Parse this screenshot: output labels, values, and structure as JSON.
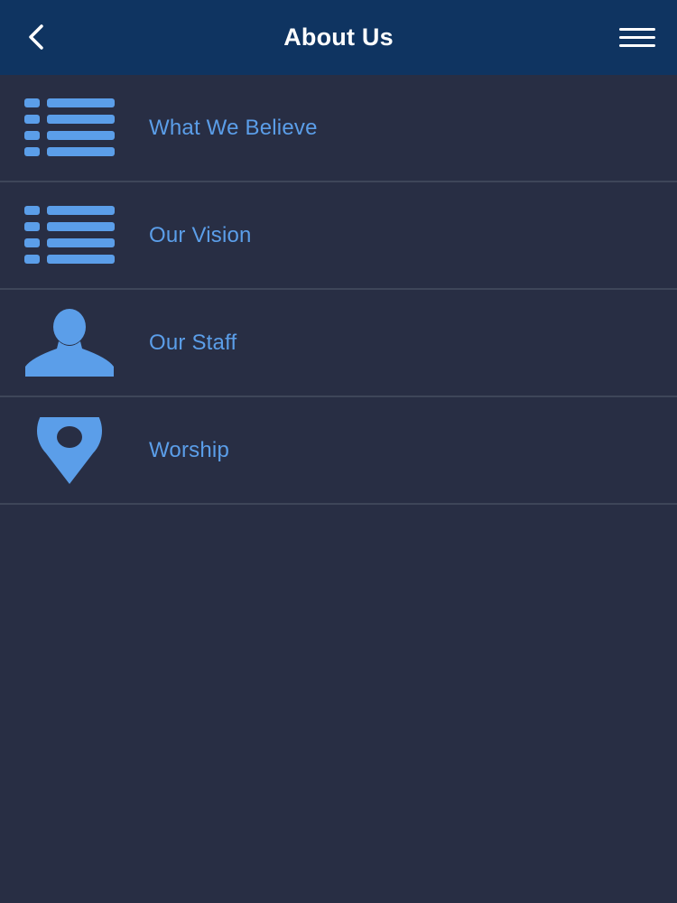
{
  "header": {
    "title": "About Us",
    "back_icon": "chevron-left-icon",
    "menu_icon": "hamburger-menu-icon"
  },
  "menu": {
    "items": [
      {
        "label": "What We Believe",
        "icon": "list-icon"
      },
      {
        "label": "Our Vision",
        "icon": "list-icon"
      },
      {
        "label": "Our Staff",
        "icon": "person-icon"
      },
      {
        "label": "Worship",
        "icon": "map-pin-icon"
      }
    ]
  },
  "colors": {
    "header_bg": "#0f3461",
    "page_bg": "#282e44",
    "accent": "#5b9ee9",
    "divider": "#3e4659",
    "title_text": "#ffffff"
  }
}
